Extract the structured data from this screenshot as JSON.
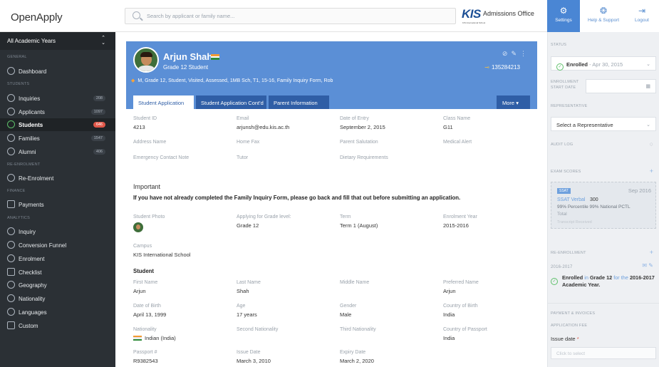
{
  "app": {
    "name": "OpenApply",
    "office": "Admissions Office",
    "school_logo": "KIS",
    "school_logo_sub": "KIS International School"
  },
  "search": {
    "placeholder": "Search by applicant or family name..."
  },
  "topnav": {
    "settings": "Settings",
    "help": "Help & Support",
    "logout": "Logout"
  },
  "sidebar": {
    "years": "All Academic Years",
    "sections": {
      "general": "GENERAL",
      "students": "STUDENTS",
      "reenrolment": "RE-ENROLMENT",
      "finance": "FINANCE",
      "analytics": "ANALYTICS"
    },
    "dashboard": "Dashboard",
    "inquiries": {
      "label": "Inquiries",
      "count": "208"
    },
    "applicants": {
      "label": "Applicants",
      "count": "1097"
    },
    "students": {
      "label": "Students",
      "count": "646"
    },
    "families": {
      "label": "Families",
      "count": "1547"
    },
    "alumni": {
      "label": "Alumni",
      "count": "406"
    },
    "reenrolment_item": "Re-Enrolment",
    "payments": "Payments",
    "inquiry": "Inquiry",
    "funnel": "Conversion Funnel",
    "enrolment": "Enrolment",
    "checklist": "Checklist",
    "geography": "Geography",
    "nationality": "Nationality",
    "languages": "Languages",
    "custom": "Custom"
  },
  "profile": {
    "name": "Arjun Shah",
    "grade": "Grade 12 Student",
    "id": "135284213",
    "tags": "M, Grade 12, Student, Visited, Assessed, 1MB Sch, T1, 15-16, Family Inquiry Form, Rob",
    "tabs": [
      "Student Application",
      "Student Application Cont'd",
      "Parent Information"
    ],
    "more": "More",
    "flag_colors": [
      "#f39a33",
      "#ffffff",
      "#2f8b3a"
    ]
  },
  "fields": {
    "student_id": {
      "k": "Student ID",
      "v": "4213"
    },
    "email": {
      "k": "Email",
      "v": "arjunsh@edu.kis.ac.th"
    },
    "entry": {
      "k": "Date of Entry",
      "v": "September 2, 2015"
    },
    "class": {
      "k": "Class Name",
      "v": "G11"
    },
    "address": "Address Name",
    "home_fax": "Home Fax",
    "salutation": "Parent Salutation",
    "medical": "Medical Alert",
    "emergency": "Emergency Contact Note",
    "tutor": "Tutor",
    "dietary": "Dietary Requirements"
  },
  "important": {
    "title": "Important",
    "text": "If you have not already completed the Family Inquiry Form, please go back and fill that out before submitting an application."
  },
  "application": {
    "photo": "Student Photo",
    "grade_level": {
      "k": "Applying for Grade level:",
      "v": "Grade 12"
    },
    "term": {
      "k": "Term",
      "v": "Term 1 (August)"
    },
    "enrol_year": {
      "k": "Enrolment Year",
      "v": "2015-2016"
    },
    "campus": {
      "k": "Campus",
      "v": "KIS International School"
    },
    "student_heading": "Student",
    "first_name": {
      "k": "First Name",
      "v": "Arjun"
    },
    "last_name": {
      "k": "Last Name",
      "v": "Shah"
    },
    "middle_name": {
      "k": "Middle Name",
      "v": ""
    },
    "preferred": {
      "k": "Preferred Name",
      "v": "Arjun"
    },
    "dob": {
      "k": "Date of Birth",
      "v": "April 13, 1999"
    },
    "age": {
      "k": "Age",
      "v": "17 years"
    },
    "gender": {
      "k": "Gender",
      "v": "Male"
    },
    "birth_country": {
      "k": "Country of Birth",
      "v": "India"
    },
    "nationality": {
      "k": "Nationality",
      "v": "Indian (India)"
    },
    "second_nat": {
      "k": "Second Nationality",
      "v": ""
    },
    "third_nat": {
      "k": "Third Nationality",
      "v": ""
    },
    "passport_country": {
      "k": "Country of Passport",
      "v": "India"
    },
    "passport_no": {
      "k": "Passport #",
      "v": "R9382543"
    },
    "issue": {
      "k": "Issue Date",
      "v": "March 3, 2010"
    },
    "expiry": {
      "k": "Expiry Date",
      "v": "March 2, 2020"
    }
  },
  "right": {
    "status_label": "STATUS",
    "status": "Enrolled",
    "status_date": "- Apr 30, 2015",
    "enrol_start": "ENROLLMENT START DATE",
    "rep_label": "REPRESENTATIVE",
    "rep_value": "Select a Representative",
    "audit": "AUDIT LOG",
    "exam": "EXAM SCORES",
    "ssat_badge": "SSAT",
    "ssat_date": "Sep 2016",
    "ssat_verbal": "SSAT Verbal",
    "ssat_score": "300",
    "ssat_pct": "99% Percentile   99% National PCTL",
    "ssat_total": "Total",
    "transcript": "Transcript Received",
    "reenrol": "RE-ENROLLMENT",
    "reenrol_year": "2016-2017",
    "reenrol_text_a": "Enrolled",
    "reenrol_text_b": "in",
    "reenrol_text_c": "Grade 12",
    "reenrol_text_d": "for the",
    "reenrol_text_e": "2016-2017 Academic Year.",
    "payment": "PAYMENT & INVOICES",
    "app_fee": "APPLICATION FEE",
    "issue_date": "Issue date",
    "click": "Click to select"
  }
}
